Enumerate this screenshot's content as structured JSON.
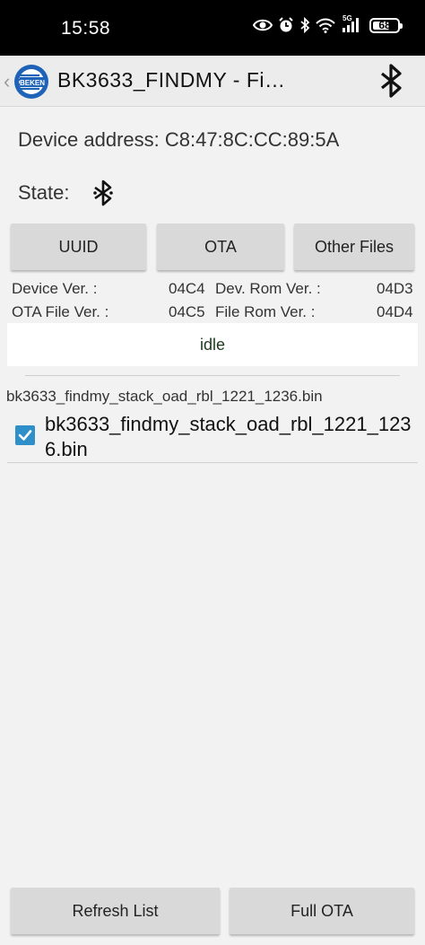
{
  "status_bar": {
    "time": "15:58",
    "network_label": "5G",
    "battery_level": "68",
    "icons": [
      "eye-icon",
      "alarm-icon",
      "bluetooth-icon",
      "wifi-icon",
      "signal-icon",
      "battery-icon"
    ]
  },
  "app_bar": {
    "back_glyph": "‹",
    "title": "BK3633_FINDMY - Fi…",
    "logo_text": "BEKEN",
    "action_icon": "bluetooth-icon"
  },
  "device": {
    "address_label": "Device address: C8:47:8C:CC:89:5A",
    "state_label": "State:"
  },
  "tabs": {
    "uuid": "UUID",
    "ota": "OTA",
    "other": "Other Files"
  },
  "versions": {
    "device_ver_label": "Device Ver. :",
    "device_ver_value": "04C4",
    "dev_rom_label": "Dev. Rom Ver. :",
    "dev_rom_value": "04D3",
    "ota_file_label": "OTA File Ver. :",
    "ota_file_value": "04C5",
    "file_rom_label": "File Rom Ver. :",
    "file_rom_value": "04D4"
  },
  "status": "idle",
  "file_header": "bk3633_findmy_stack_oad_rbl_1221_1236.bin",
  "files": [
    {
      "name": "bk3633_findmy_stack_oad_rbl_1221_1236.bin",
      "checked": true
    }
  ],
  "bottom_buttons": {
    "refresh": "Refresh List",
    "full_ota": "Full OTA"
  },
  "colors": {
    "accent": "#2f8fc8",
    "logo_blue": "#1f63b8",
    "status_text": "#1e3a1e"
  }
}
